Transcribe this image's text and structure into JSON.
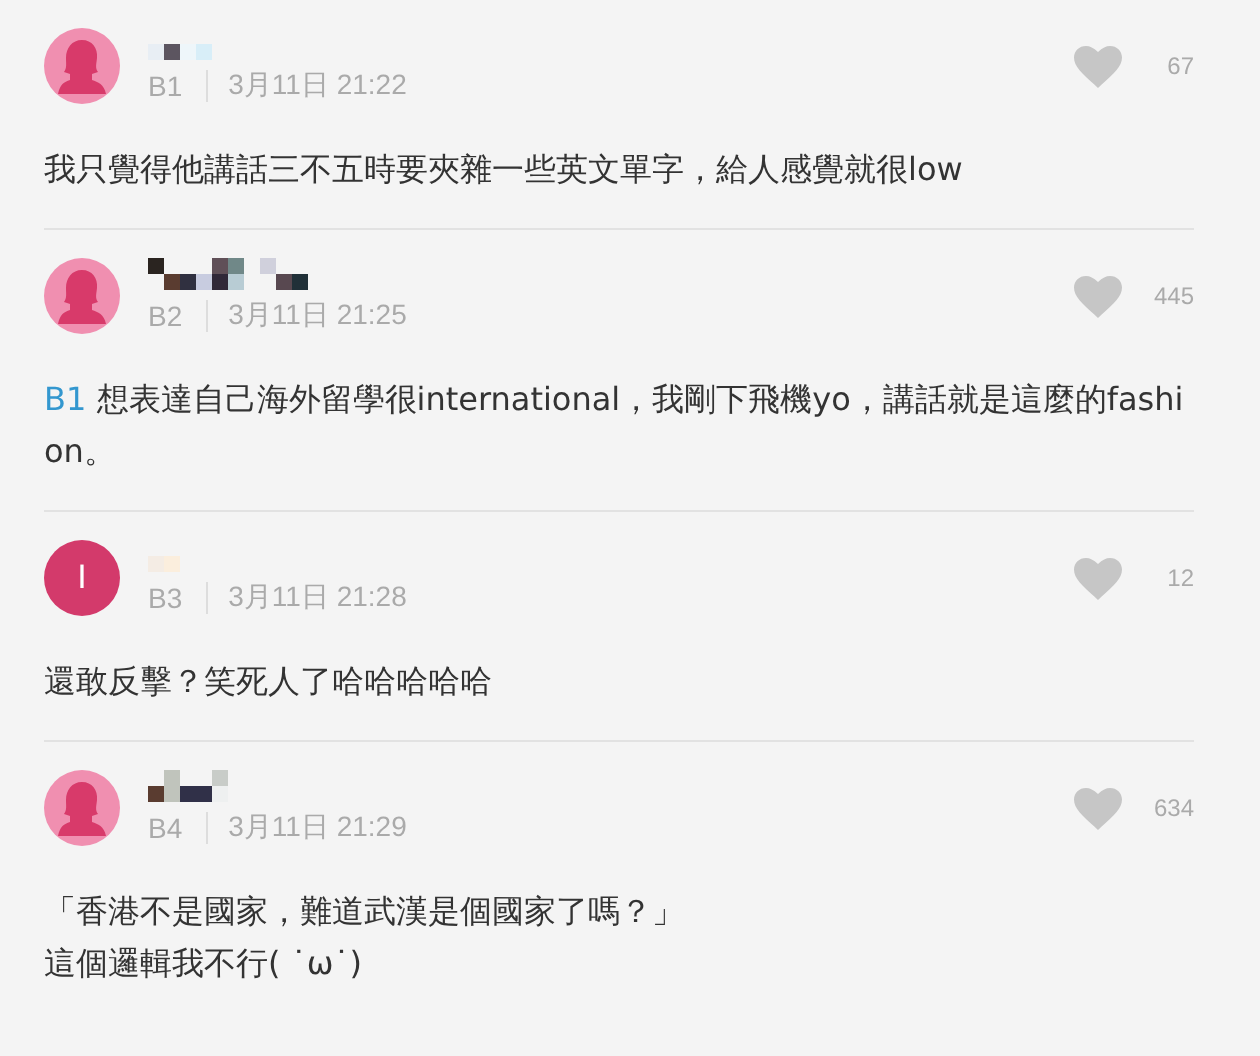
{
  "comments": [
    {
      "avatar": {
        "kind": "silhouette"
      },
      "floor": "B1",
      "time": "3月11日 21:22",
      "likes": "67",
      "text": "我只覺得他講話三不五時要夾雜一些英文單字，給人感覺就很low"
    },
    {
      "avatar": {
        "kind": "silhouette"
      },
      "floor": "B2",
      "time": "3月11日 21:25",
      "likes": "445",
      "mention": "B1",
      "text": "想表達自己海外留學很international，我剛下飛機yo，講話就是這麼的fashion。"
    },
    {
      "avatar": {
        "kind": "letter",
        "letter": "I"
      },
      "floor": "B3",
      "time": "3月11日 21:28",
      "likes": "12",
      "text": "還敢反擊？笑死人了哈哈哈哈哈"
    },
    {
      "avatar": {
        "kind": "silhouette"
      },
      "floor": "B4",
      "time": "3月11日 21:29",
      "likes": "634",
      "text": "「香港不是國家，難道武漢是個國家了嗎？」",
      "text_2": "這個邏輯我不行( ˙ω˙)"
    }
  ]
}
